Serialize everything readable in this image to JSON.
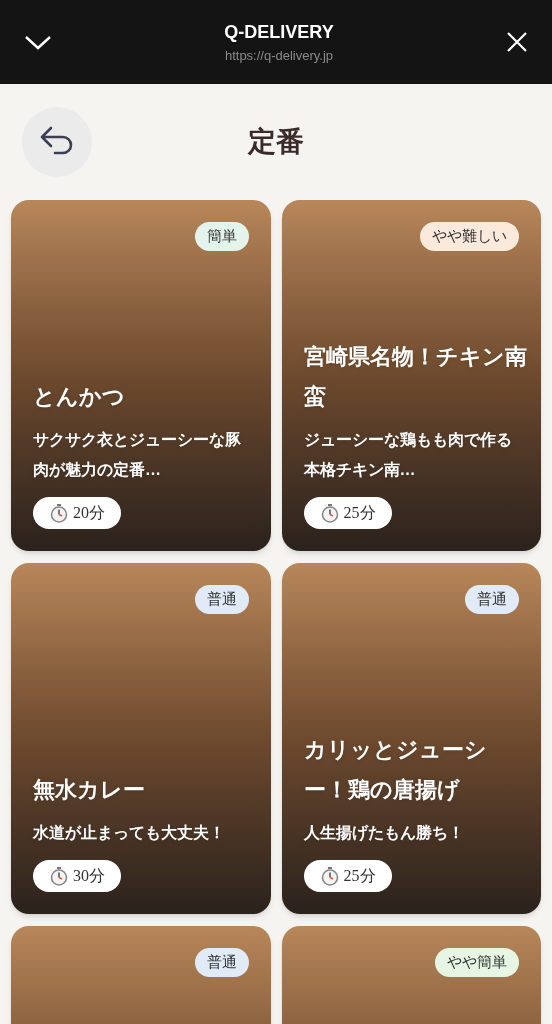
{
  "browser_bar": {
    "title": "Q-DELIVERY",
    "url": "https://q-delivery.jp"
  },
  "page": {
    "title": "定番"
  },
  "recipes": [
    {
      "title": "とんかつ",
      "description": "サクサク衣とジューシーな豚肉が魅力の定番…",
      "time": "20分",
      "difficulty": {
        "label": "簡単",
        "color": "#e3f4ec"
      }
    },
    {
      "title": "宮崎県名物！チキン南蛮",
      "description": "ジューシーな鶏もも肉で作る本格チキン南…",
      "time": "25分",
      "difficulty": {
        "label": "やや難しい",
        "color": "#fbeadb"
      }
    },
    {
      "title": "無水カレー",
      "description": "水道が止まっても大丈夫！",
      "time": "30分",
      "difficulty": {
        "label": "普通",
        "color": "#e1eaf7"
      }
    },
    {
      "title": "カリッとジューシー！鶏の唐揚げ",
      "description": "人生揚げたもん勝ち！",
      "time": "25分",
      "difficulty": {
        "label": "普通",
        "color": "#e1eaf7"
      }
    },
    {
      "difficulty": {
        "label": "普通",
        "color": "#e1eaf7"
      }
    },
    {
      "difficulty": {
        "label": "やや簡単",
        "color": "#e6f5e4"
      }
    }
  ]
}
